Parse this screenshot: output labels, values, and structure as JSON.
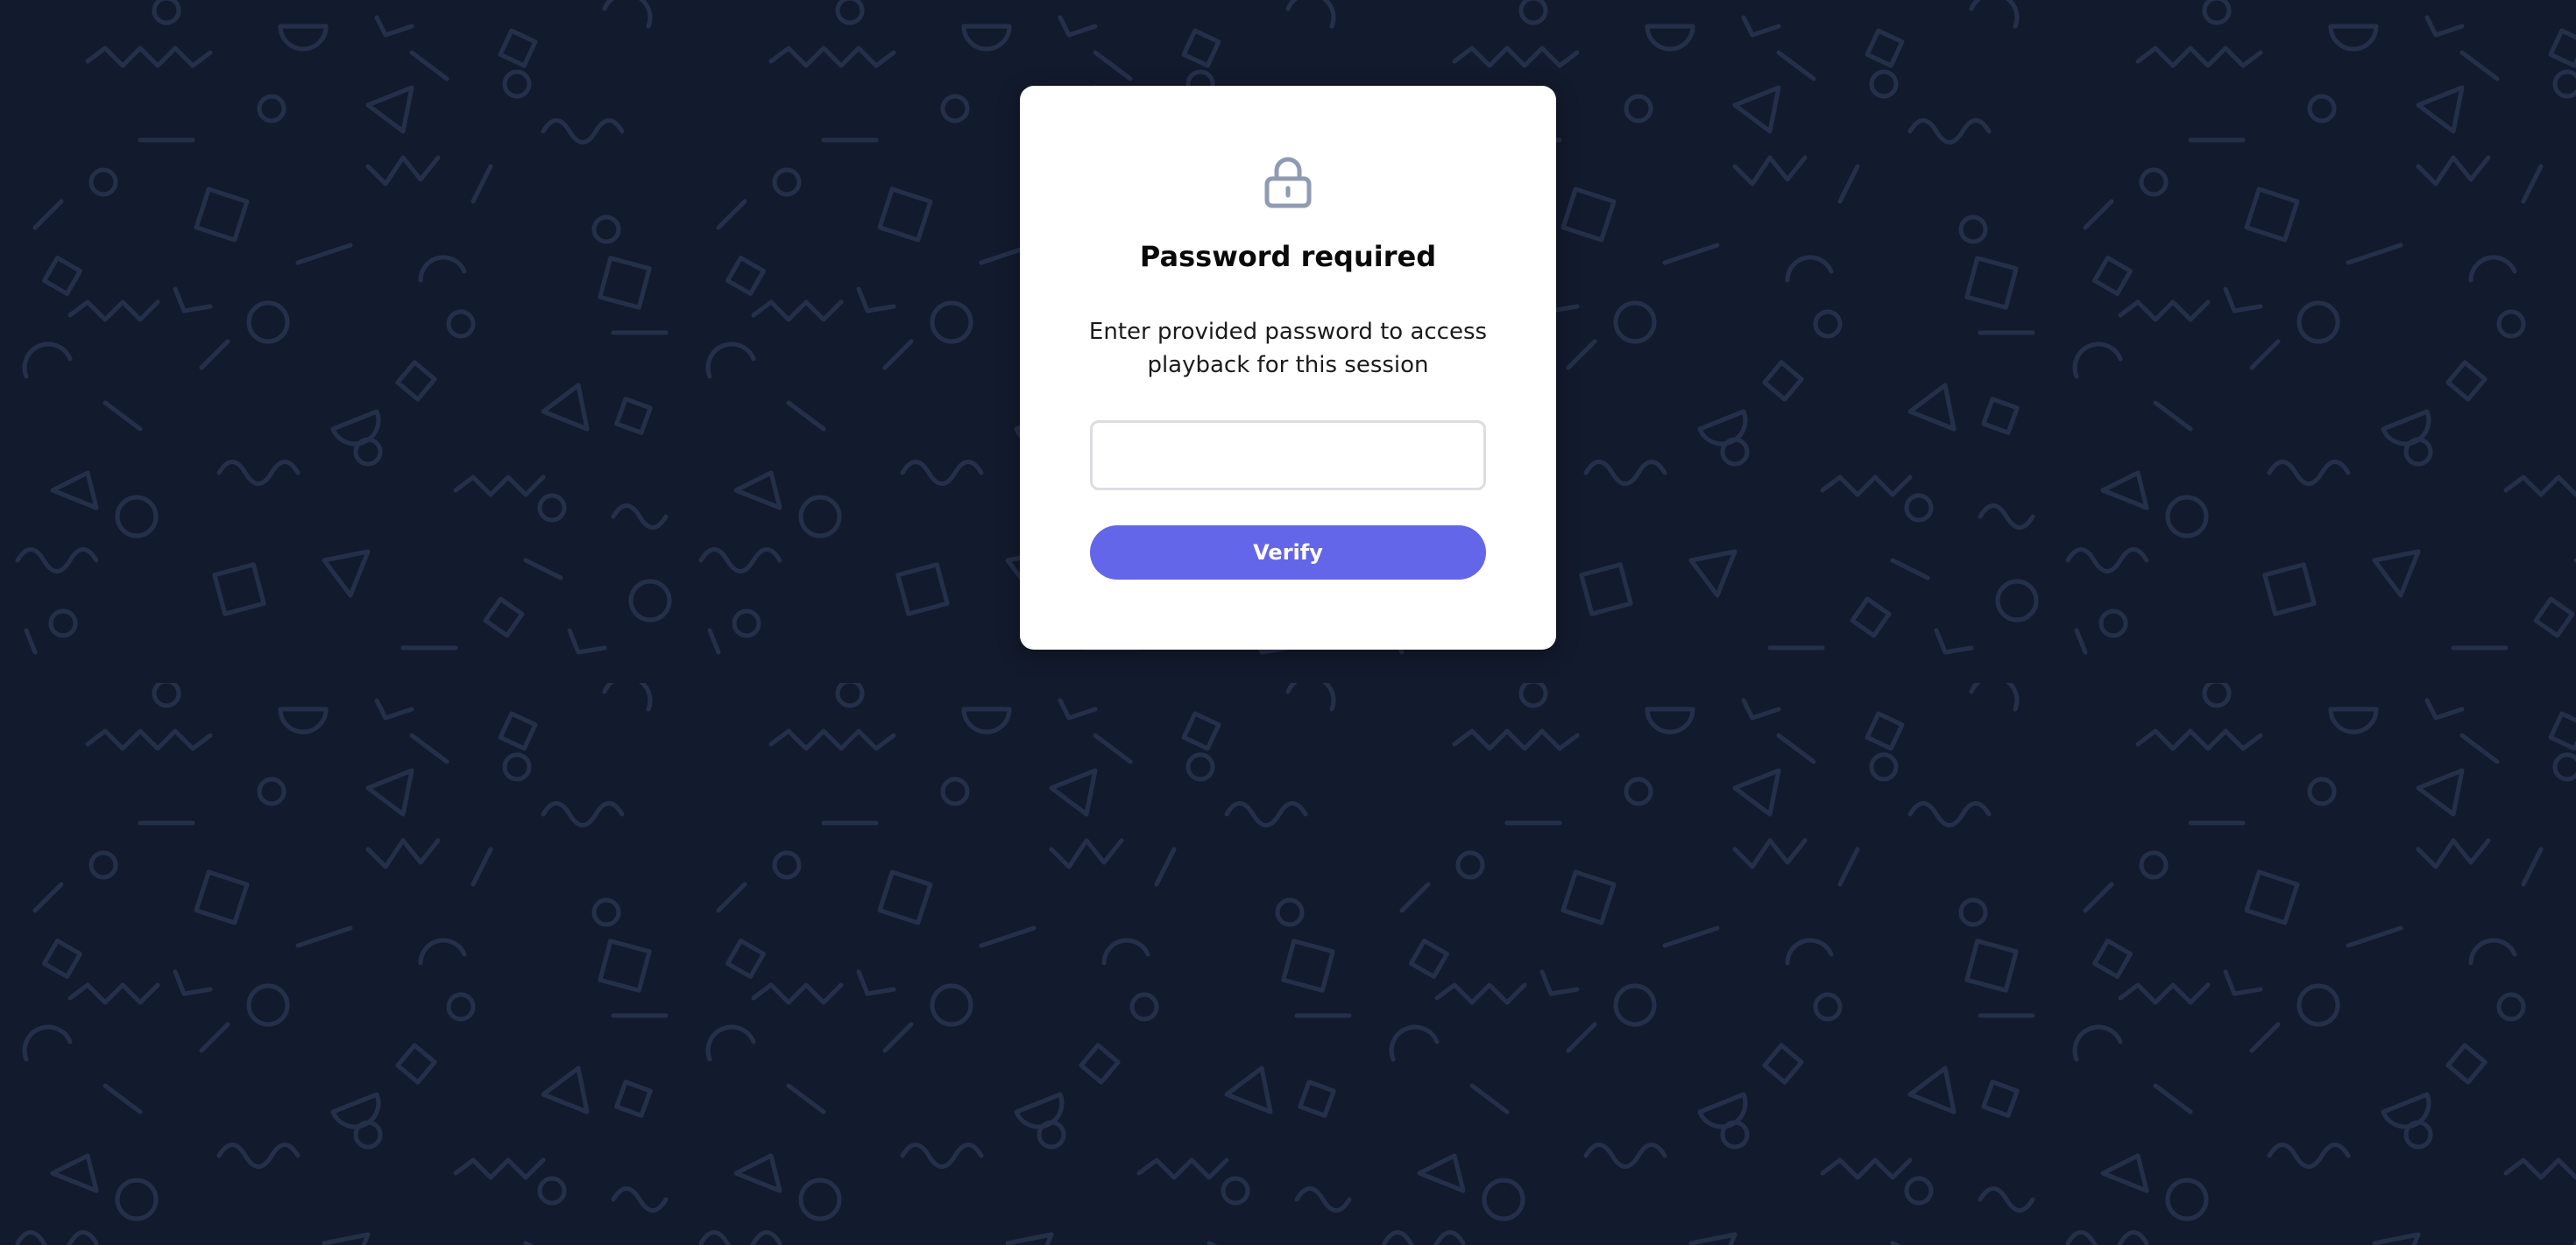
{
  "modal": {
    "icon": "lock-icon",
    "title": "Password required",
    "description": "Enter provided password to access playback for this session",
    "password_input": {
      "value": "",
      "placeholder": ""
    },
    "verify_label": "Verify"
  },
  "colors": {
    "background": "#121a2d",
    "pattern": "#263248",
    "card": "#ffffff",
    "accent": "#6466e9",
    "icon": "#8f9bb0"
  }
}
